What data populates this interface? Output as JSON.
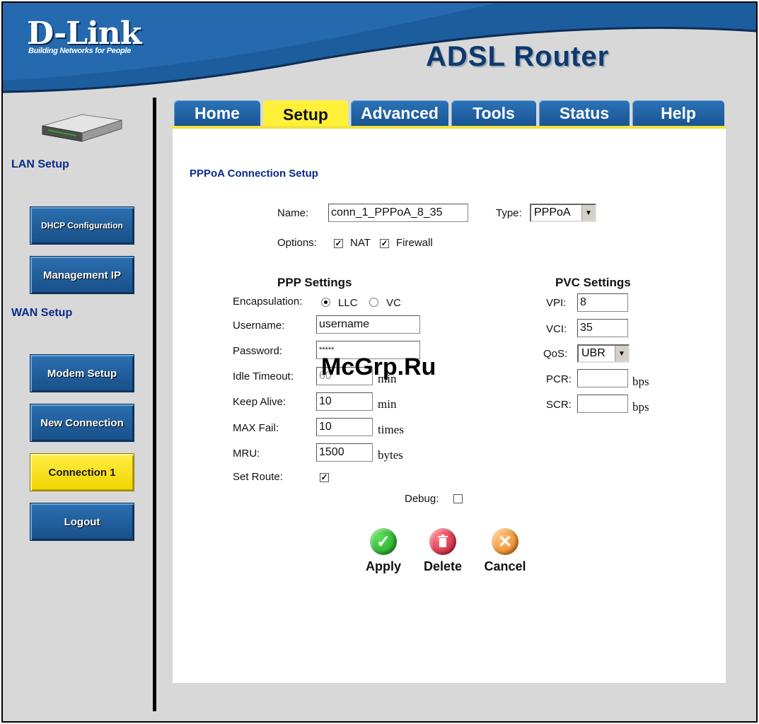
{
  "header": {
    "logo": "D-Link",
    "tagline": "Building Networks for People",
    "product": "ADSL Router"
  },
  "tabs": [
    {
      "label": "Home"
    },
    {
      "label": "Setup",
      "active": true
    },
    {
      "label": "Advanced"
    },
    {
      "label": "Tools"
    },
    {
      "label": "Status"
    },
    {
      "label": "Help"
    }
  ],
  "sidebar": {
    "lan_heading": "LAN Setup",
    "wan_heading": "WAN Setup",
    "buttons": [
      {
        "label": "DHCP Configuration"
      },
      {
        "label": "Management IP"
      },
      {
        "label": "Modem Setup"
      },
      {
        "label": "New Connection"
      },
      {
        "label": "Connection 1",
        "active": true
      },
      {
        "label": "Logout"
      }
    ]
  },
  "page": {
    "title": "PPPoA Connection Setup",
    "name_label": "Name:",
    "name_value": "conn_1_PPPoA_8_35",
    "type_label": "Type:",
    "type_value": "PPPoA",
    "options_label": "Options:",
    "nat_label": "NAT",
    "nat_checked": true,
    "firewall_label": "Firewall",
    "firewall_checked": true
  },
  "ppp": {
    "heading": "PPP Settings",
    "encapsulation_label": "Encapsulation:",
    "llc_label": "LLC",
    "vc_label": "VC",
    "encapsulation_value": "LLC",
    "username_label": "Username:",
    "username_value": "username",
    "password_label": "Password:",
    "password_value": "*****",
    "idle_label": "Idle Timeout:",
    "idle_value": "60",
    "idle_unit": "min",
    "keepalive_label": "Keep Alive:",
    "keepalive_value": "10",
    "keepalive_unit": "min",
    "maxfail_label": "MAX Fail:",
    "maxfail_value": "10",
    "maxfail_unit": "times",
    "mru_label": "MRU:",
    "mru_value": "1500",
    "mru_unit": "bytes",
    "setroute_label": "Set Route:",
    "setroute_checked": true,
    "debug_label": "Debug:",
    "debug_checked": false
  },
  "pvc": {
    "heading": "PVC Settings",
    "vpi_label": "VPI:",
    "vpi_value": "8",
    "vci_label": "VCI:",
    "vci_value": "35",
    "qos_label": "QoS:",
    "qos_value": "UBR",
    "pcr_label": "PCR:",
    "pcr_value": "",
    "pcr_unit": "bps",
    "scr_label": "SCR:",
    "scr_value": "",
    "scr_unit": "bps"
  },
  "actions": {
    "apply": "Apply",
    "delete": "Delete",
    "cancel": "Cancel"
  },
  "watermark": "McGrp.Ru",
  "colors": {
    "brand_blue": "#1b5592",
    "active_yellow": "#fff03a",
    "heading_navy": "#0a2a8a"
  }
}
